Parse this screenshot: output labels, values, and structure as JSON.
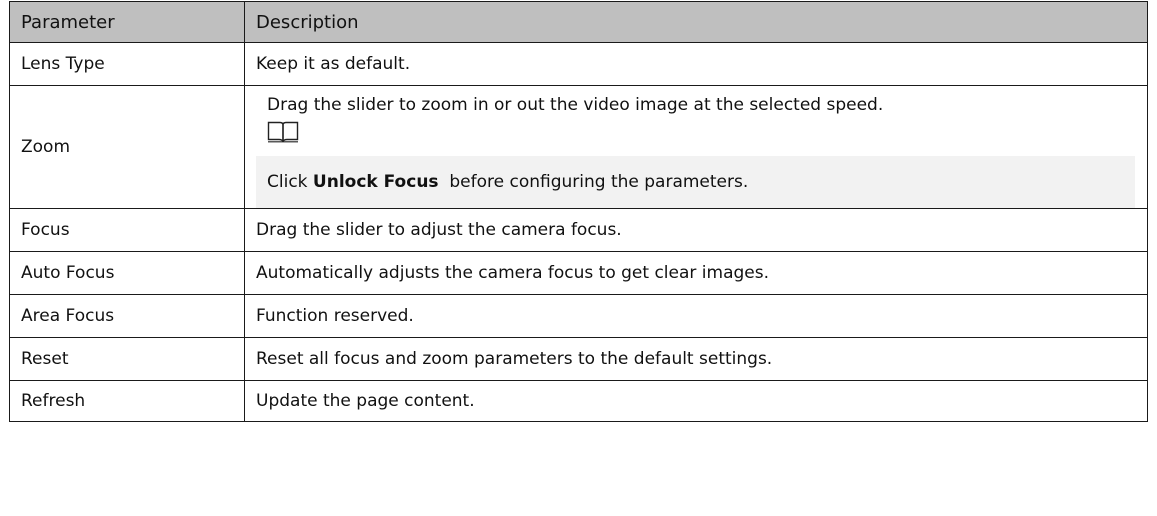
{
  "table": {
    "headers": [
      "Parameter",
      "Description"
    ],
    "rows": [
      {
        "parameter": "Lens Type",
        "description": "Keep it as default."
      },
      {
        "parameter": "Zoom",
        "description": "Drag the slider to zoom in or out the video image at the selected speed.",
        "note": {
          "icon": "book-icon",
          "prefix": "Click ",
          "bold": "Unlock Focus",
          "suffix": "  before configuring the parameters."
        }
      },
      {
        "parameter": "Focus",
        "description": "Drag the slider to adjust the camera focus."
      },
      {
        "parameter": "Auto Focus",
        "description": "Automatically adjusts the camera focus to get clear images."
      },
      {
        "parameter": "Area Focus",
        "description": "Function reserved."
      },
      {
        "parameter": "Reset",
        "description": "Reset all focus and zoom parameters to the default settings."
      },
      {
        "parameter": "Refresh",
        "description": "Update the page content."
      }
    ]
  },
  "colors": {
    "header_bg": "#bfbfbf",
    "note_bg": "#f2f2f2",
    "border": "#1a1a1a"
  }
}
